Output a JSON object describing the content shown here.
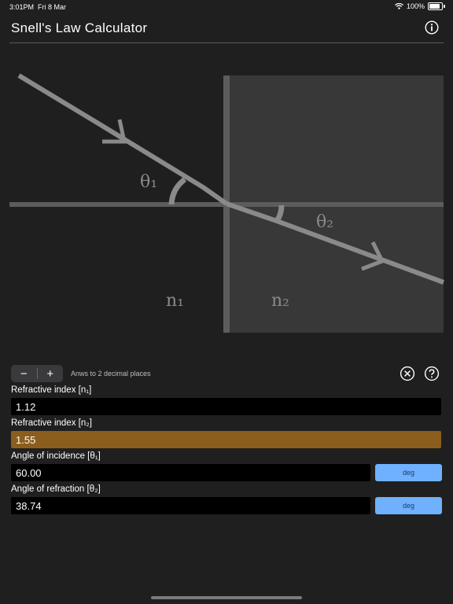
{
  "status": {
    "time": "3:01PM",
    "date": "Fri 8 Mar",
    "battery": "100%"
  },
  "header": {
    "title": "Snell's Law Calculator"
  },
  "diagram": {
    "theta1": "θ₁",
    "theta2": "θ₂",
    "n1": "n₁",
    "n2": "n₂",
    "colors": {
      "ray": "#8a8a8a",
      "medium2": "#383838",
      "line": "#5c5c5c"
    }
  },
  "controls": {
    "minus": "−",
    "plus": "+",
    "precision": "Anws to 2 decimal places"
  },
  "fields": [
    {
      "label": "Refractive index [n₁]",
      "value": "1.12"
    },
    {
      "label": "Refractive index [n₂]",
      "value": "1.55",
      "highlight": "#8c5e1d"
    },
    {
      "label": "Angle of incidence [θ₁]",
      "value": "60.00",
      "unit": "deg"
    },
    {
      "label": "Angle of refraction [θ₂]",
      "value": "38.74",
      "unit": "deg"
    }
  ],
  "accent": "#6fb0ff"
}
